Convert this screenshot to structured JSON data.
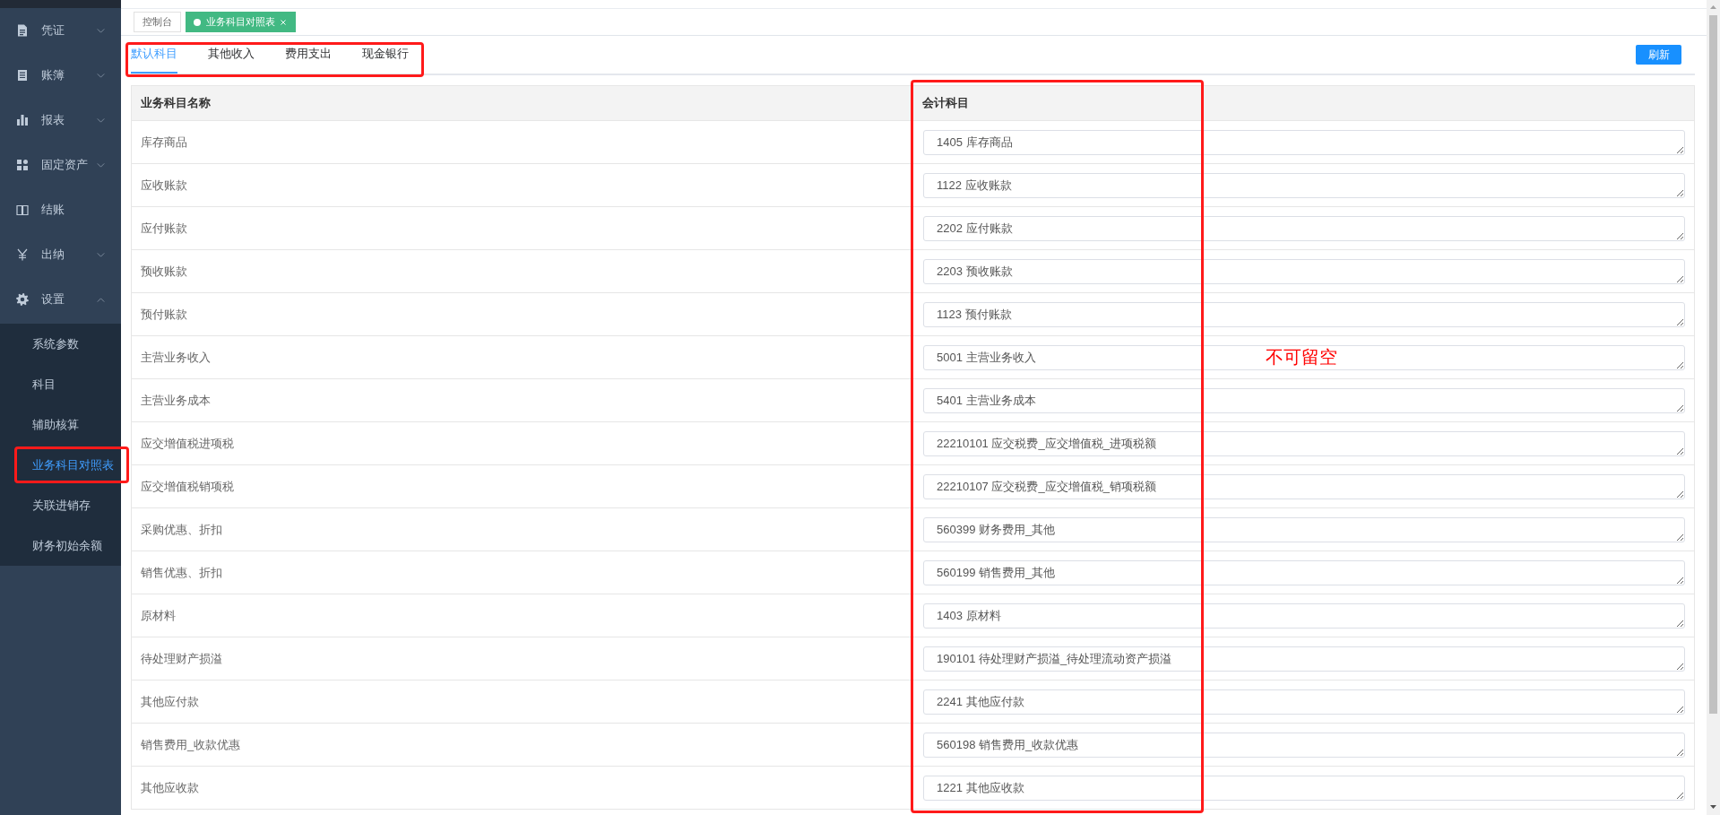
{
  "sidebar": {
    "menus": [
      {
        "label": "凭证",
        "expanded": false
      },
      {
        "label": "账簿",
        "expanded": false
      },
      {
        "label": "报表",
        "expanded": false
      },
      {
        "label": "固定资产",
        "expanded": false
      },
      {
        "label": "结账"
      },
      {
        "label": "出纳",
        "expanded": false
      },
      {
        "label": "设置",
        "expanded": true,
        "children": [
          {
            "label": "系统参数",
            "selected": false,
            "highlighted": false
          },
          {
            "label": "科目",
            "selected": false,
            "highlighted": false
          },
          {
            "label": "辅助核算",
            "selected": false,
            "highlighted": false
          },
          {
            "label": "业务科目对照表",
            "selected": true,
            "highlighted": true
          },
          {
            "label": "关联进销存",
            "selected": false,
            "highlighted": false
          },
          {
            "label": "财务初始余额",
            "selected": false,
            "highlighted": false
          }
        ]
      }
    ]
  },
  "page_tags": [
    {
      "label": "控制台",
      "selected": false
    },
    {
      "label": "业务科目对照表",
      "selected": true
    }
  ],
  "tabs": {
    "highlighted": true,
    "items": [
      {
        "label": "默认科目",
        "selected": true
      },
      {
        "label": "其他收入",
        "selected": false
      },
      {
        "label": "费用支出",
        "selected": false
      },
      {
        "label": "现金银行",
        "selected": false
      }
    ]
  },
  "refresh_button": "刷新",
  "table": {
    "columns": [
      {
        "label": "业务科目名称",
        "highlighted": false
      },
      {
        "label": "会计科目",
        "highlighted": true
      }
    ],
    "rows": [
      {
        "name": "库存商品",
        "account": "1405 库存商品"
      },
      {
        "name": "应收账款",
        "account": "1122 应收账款"
      },
      {
        "name": "应付账款",
        "account": "2202 应付账款"
      },
      {
        "name": "预收账款",
        "account": "2203 预收账款"
      },
      {
        "name": "预付账款",
        "account": "1123 预付账款"
      },
      {
        "name": "主营业务收入",
        "account": "5001 主营业务收入"
      },
      {
        "name": "主营业务成本",
        "account": "5401 主营业务成本"
      },
      {
        "name": "应交增值税进项税",
        "account": "22210101 应交税费_应交增值税_进项税额"
      },
      {
        "name": "应交增值税销项税",
        "account": "22210107 应交税费_应交增值税_销项税额"
      },
      {
        "name": "采购优惠、折扣",
        "account": "560399 财务费用_其他"
      },
      {
        "name": "销售优惠、折扣",
        "account": "560199 销售费用_其他"
      },
      {
        "name": "原材料",
        "account": "1403 原材料"
      },
      {
        "name": "待处理财产损溢",
        "account": "190101 待处理财产损溢_待处理流动资产损溢"
      },
      {
        "name": "其他应付款",
        "account": "2241 其他应付款"
      },
      {
        "name": "销售费用_收款优惠",
        "account": "560198 销售费用_收款优惠"
      },
      {
        "name": "其他应收款",
        "account": "1221 其他应收款"
      }
    ]
  },
  "annotation": {
    "text": "不可留空"
  }
}
